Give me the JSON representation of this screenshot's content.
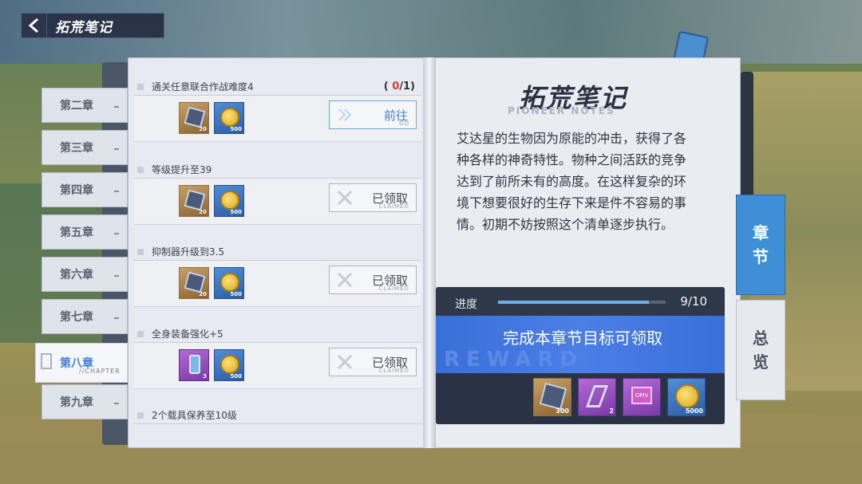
{
  "header": {
    "title": "拓荒笔记"
  },
  "chapters": [
    {
      "label": "第二章"
    },
    {
      "label": "第三章"
    },
    {
      "label": "第四章"
    },
    {
      "label": "第五章"
    },
    {
      "label": "第六章"
    },
    {
      "label": "第七章"
    },
    {
      "label": "第八章",
      "sub": "//CHAPTER",
      "active": true
    },
    {
      "label": "第九章"
    }
  ],
  "tasks": [
    {
      "name": "通关任意联合作战难度4",
      "progress_open": "(",
      "progress_done": "0",
      "progress_total": "/1)",
      "rewards": [
        {
          "icon": "cube-icon",
          "qty": "20"
        },
        {
          "icon": "coin-icon",
          "qty": "500"
        }
      ],
      "button": "前往",
      "button_en": "GO",
      "state": "go"
    },
    {
      "name": "等级提升至39",
      "rewards": [
        {
          "icon": "cube-icon",
          "qty": "20"
        },
        {
          "icon": "coin-icon",
          "qty": "500"
        }
      ],
      "button": "已领取",
      "button_en": "CLAIMED",
      "state": "claimed"
    },
    {
      "name": "抑制器升级到3.5",
      "rewards": [
        {
          "icon": "cube-icon",
          "qty": "20"
        },
        {
          "icon": "coin-icon",
          "qty": "500"
        }
      ],
      "button": "已领取",
      "button_en": "CLAIMED",
      "state": "claimed"
    },
    {
      "name": "全身装备强化+5",
      "rewards": [
        {
          "icon": "bottle-icon",
          "qty": "3"
        },
        {
          "icon": "coin-icon",
          "qty": "500"
        }
      ],
      "button": "已领取",
      "button_en": "CLAIMED",
      "state": "claimed"
    },
    {
      "name": "2个载具保养至10级"
    }
  ],
  "notes": {
    "title": "拓荒笔记",
    "subtitle": "PIONEER NOTES",
    "text": "艾达星的生物因为原能的冲击，获得了各种各样的神奇特性。物种之间活跃的竞争达到了前所未有的高度。在这样复杂的环境下想要很好的生存下来是件不容易的事情。初期不妨按照这个清单逐步执行。"
  },
  "progress": {
    "label": "进度",
    "current": "9",
    "total": "10",
    "display": "9/10",
    "fraction": 0.9,
    "claim_text": "完成本章节目标可领取",
    "watermark": "REWARD",
    "rewards": [
      {
        "icon": "cube-icon",
        "qty": "300",
        "color": "gold"
      },
      {
        "icon": "bolt-icon",
        "qty": "2",
        "color": "purple"
      },
      {
        "icon": "chip-icon",
        "qty": "",
        "label": "OPIV",
        "color": "purple"
      },
      {
        "icon": "coin-icon",
        "qty": "5000",
        "color": "blue"
      }
    ]
  },
  "side_tabs": [
    {
      "chars": [
        "章",
        "节"
      ],
      "active": true
    },
    {
      "chars": [
        "总",
        "览"
      ],
      "active": false
    }
  ],
  "colors": {
    "accent": "#3a80d8",
    "progress_red": "#d23e3e",
    "claim_blue": "#3a6fd8"
  }
}
